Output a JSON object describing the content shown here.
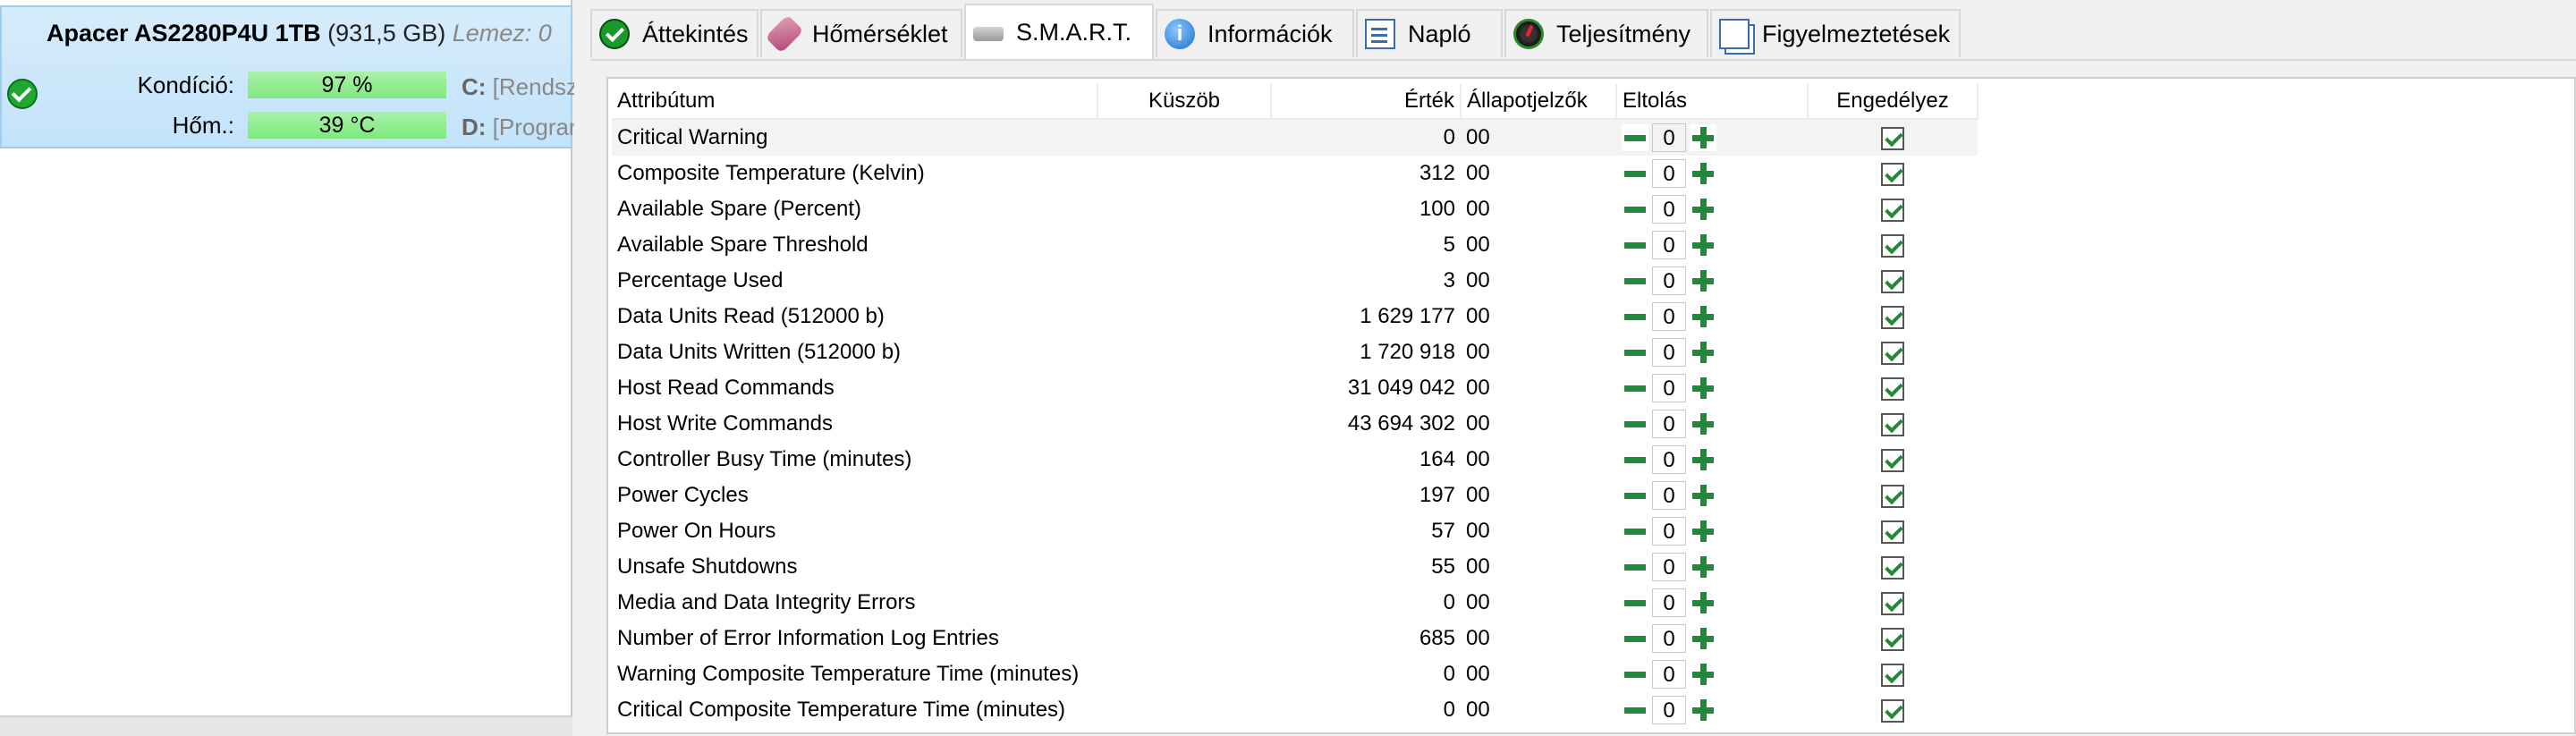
{
  "drive": {
    "name": "Apacer AS2280P4U 1TB",
    "size": "(931,5 GB)",
    "disk_label": "Lemez: 0",
    "health_label": "Kondíció:",
    "health_value": "97 %",
    "temp_label": "Hőm.:",
    "temp_value": "39 °C",
    "volumes": [
      {
        "letter": "C:",
        "name": "[Rendszer]"
      },
      {
        "letter": "D:",
        "name": "[Programok]"
      }
    ]
  },
  "tabs": [
    {
      "label": "Áttekintés",
      "icon": "check-icon"
    },
    {
      "label": "Hőmérséklet",
      "icon": "thermometer-icon"
    },
    {
      "label": "S.M.A.R.T.",
      "icon": "disk-icon"
    },
    {
      "label": "Információk",
      "icon": "info-icon"
    },
    {
      "label": "Napló",
      "icon": "log-icon"
    },
    {
      "label": "Teljesítmény",
      "icon": "gauge-icon"
    },
    {
      "label": "Figyelmeztetések",
      "icon": "pages-icon"
    }
  ],
  "active_tab": "S.M.A.R.T.",
  "smart": {
    "headers": {
      "attribute": "Attribútum",
      "threshold": "Küszöb",
      "value": "Érték",
      "flags": "Állapotjelzők",
      "offset": "Eltolás",
      "enabled": "Engedélyez"
    },
    "rows": [
      {
        "attribute": "Critical Warning",
        "threshold": "",
        "value": "0",
        "flags": "00",
        "offset": "0"
      },
      {
        "attribute": "Composite Temperature (Kelvin)",
        "threshold": "",
        "value": "312",
        "flags": "00",
        "offset": "0"
      },
      {
        "attribute": "Available Spare (Percent)",
        "threshold": "",
        "value": "100",
        "flags": "00",
        "offset": "0"
      },
      {
        "attribute": "Available Spare Threshold",
        "threshold": "",
        "value": "5",
        "flags": "00",
        "offset": "0"
      },
      {
        "attribute": "Percentage Used",
        "threshold": "",
        "value": "3",
        "flags": "00",
        "offset": "0"
      },
      {
        "attribute": "Data Units Read (512000 b)",
        "threshold": "",
        "value": "1 629 177",
        "flags": "00",
        "offset": "0"
      },
      {
        "attribute": "Data Units Written (512000 b)",
        "threshold": "",
        "value": "1 720 918",
        "flags": "00",
        "offset": "0"
      },
      {
        "attribute": "Host Read Commands",
        "threshold": "",
        "value": "31 049 042",
        "flags": "00",
        "offset": "0"
      },
      {
        "attribute": "Host Write Commands",
        "threshold": "",
        "value": "43 694 302",
        "flags": "00",
        "offset": "0"
      },
      {
        "attribute": "Controller Busy Time (minutes)",
        "threshold": "",
        "value": "164",
        "flags": "00",
        "offset": "0"
      },
      {
        "attribute": "Power Cycles",
        "threshold": "",
        "value": "197",
        "flags": "00",
        "offset": "0"
      },
      {
        "attribute": "Power On Hours",
        "threshold": "",
        "value": "57",
        "flags": "00",
        "offset": "0"
      },
      {
        "attribute": "Unsafe Shutdowns",
        "threshold": "",
        "value": "55",
        "flags": "00",
        "offset": "0"
      },
      {
        "attribute": "Media and Data Integrity Errors",
        "threshold": "",
        "value": "0",
        "flags": "00",
        "offset": "0"
      },
      {
        "attribute": "Number of Error Information Log Entries",
        "threshold": "",
        "value": "685",
        "flags": "00",
        "offset": "0"
      },
      {
        "attribute": "Warning Composite Temperature Time (minutes)",
        "threshold": "",
        "value": "0",
        "flags": "00",
        "offset": "0"
      },
      {
        "attribute": "Critical Composite Temperature Time (minutes)",
        "threshold": "",
        "value": "0",
        "flags": "00",
        "offset": "0"
      }
    ]
  },
  "colors": {
    "accent_green": "#1f8a3a",
    "health_bar": "#7ee87e",
    "selected_drive": "#c3e3fa"
  }
}
